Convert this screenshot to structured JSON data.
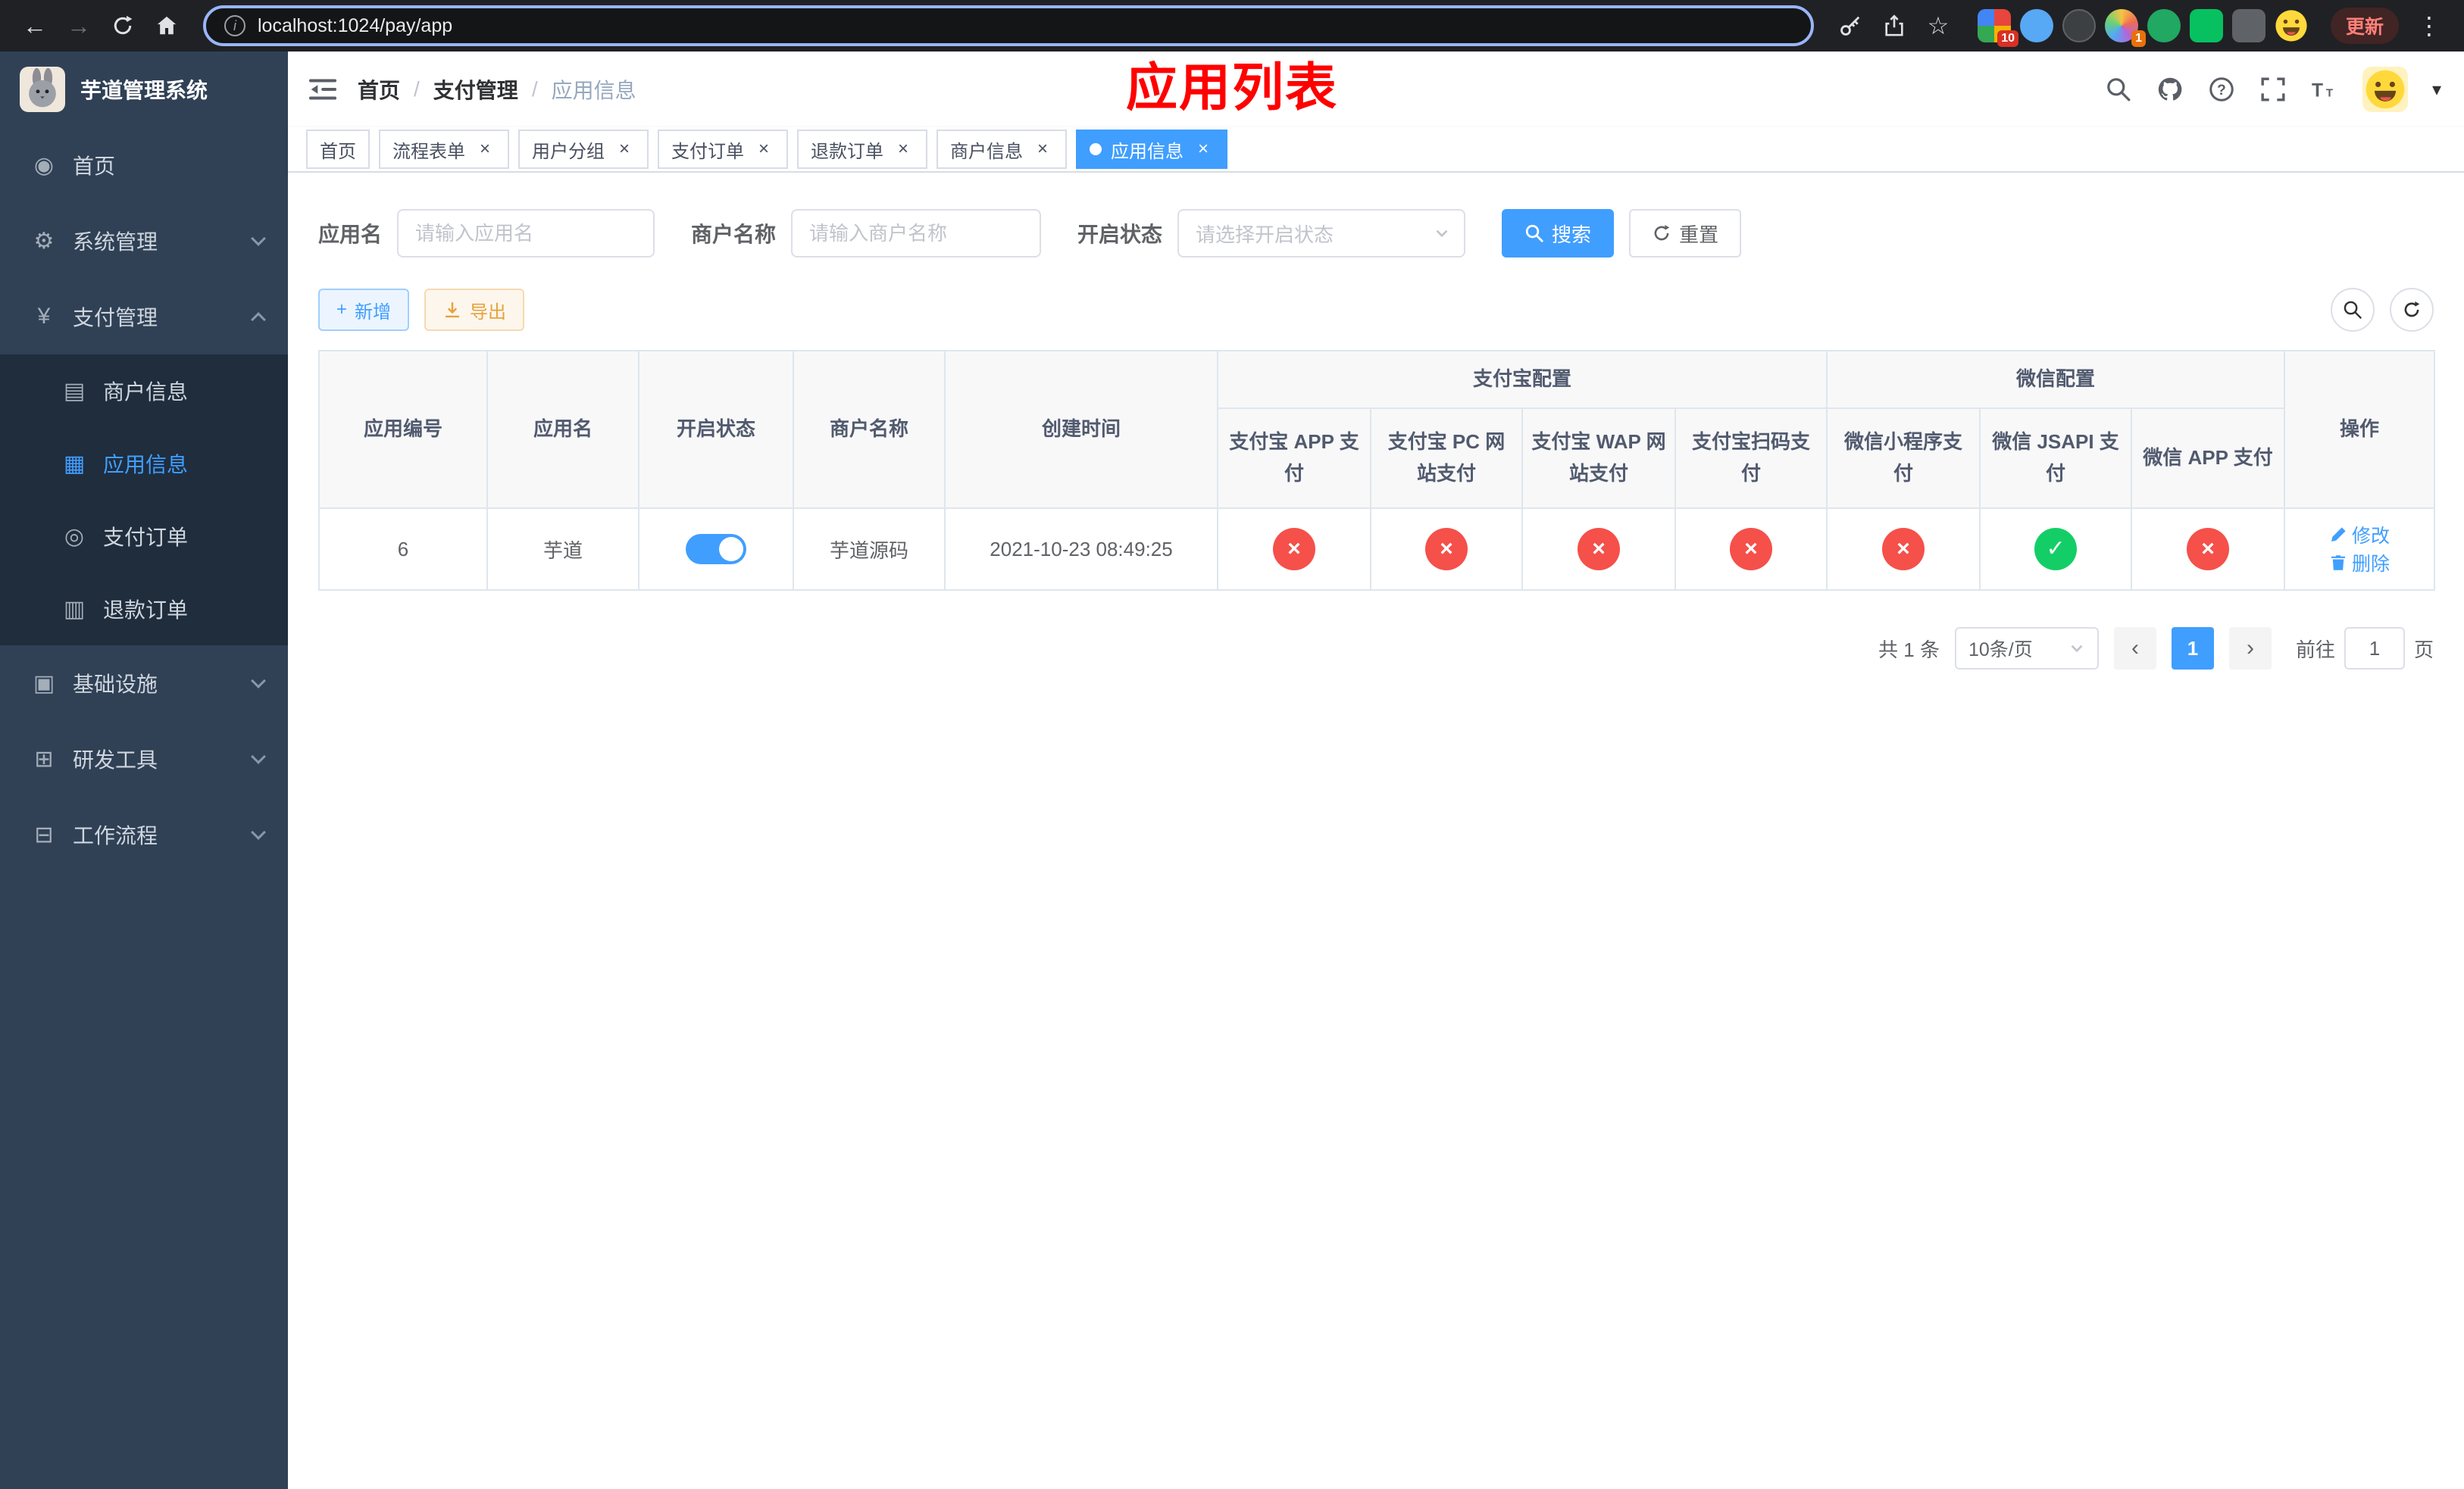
{
  "colors": {
    "accent": "#409eff",
    "success": "#13ce66",
    "danger": "#f5504a",
    "warning": "#e6a23c",
    "annotation_red": "#ff0000",
    "sidebar_bg": "#304156",
    "submenu_bg": "#1f2d3d"
  },
  "icons": {
    "back": "←",
    "forward": "→",
    "bookmark_star": "☆",
    "menu_dots": "⋮",
    "info": "i",
    "caret_down": "▾",
    "close": "×",
    "check": "✓",
    "cross": "×",
    "plus": "+",
    "prev": "‹",
    "next": "›",
    "dashboard": "◉",
    "gear": "⚙",
    "yen": "¥",
    "merchant_card": "▤",
    "app_grid": "▦",
    "pay_order": "◎",
    "refund_order": "▥",
    "infra": "▣",
    "dev_tools": "⊞",
    "workflow": "⊟"
  },
  "browser": {
    "url": "localhost:1024/pay/app",
    "update_label": "更新",
    "badges": {
      "extensions": "10",
      "avatar_ext": "1"
    }
  },
  "sidebar": {
    "title": "芋道管理系统",
    "items": {
      "home": "首页",
      "system": "系统管理",
      "payment": "支付管理",
      "merchant": "商户信息",
      "app": "应用信息",
      "pay_order": "支付订单",
      "refund_order": "退款订单",
      "infra": "基础设施",
      "dev_tools": "研发工具",
      "workflow": "工作流程"
    }
  },
  "header": {
    "breadcrumb": {
      "home": "首页",
      "section": "支付管理",
      "current": "应用信息",
      "sep": "/"
    },
    "annotation": "应用列表"
  },
  "tabs": [
    {
      "label": "首页"
    },
    {
      "label": "流程表单"
    },
    {
      "label": "用户分组"
    },
    {
      "label": "支付订单"
    },
    {
      "label": "退款订单"
    },
    {
      "label": "商户信息"
    },
    {
      "label": "应用信息"
    }
  ],
  "filters": {
    "app_name": {
      "label": "应用名",
      "placeholder": "请输入应用名"
    },
    "merchant_name": {
      "label": "商户名称",
      "placeholder": "请输入商户名称"
    },
    "status": {
      "label": "开启状态",
      "placeholder": "请选择开启状态"
    },
    "search_label": "搜索",
    "reset_label": "重置"
  },
  "toolbar": {
    "add_label": "新增",
    "export_label": "导出"
  },
  "table": {
    "groups": {
      "alipay": "支付宝配置",
      "wechat": "微信配置"
    },
    "columns": {
      "id": "应用编号",
      "name": "应用名",
      "status": "开启状态",
      "merchant": "商户名称",
      "created": "创建时间",
      "alipay_app": "支付宝 APP 支付",
      "alipay_pc": "支付宝 PC 网站支付",
      "alipay_wap": "支付宝 WAP 网站支付",
      "alipay_qr": "支付宝扫码支付",
      "wx_lite": "微信小程序支付",
      "wx_jsapi": "微信 JSAPI 支付",
      "wx_app": "微信 APP 支付",
      "actions": "操作"
    },
    "row": {
      "id": "6",
      "name": "芋道",
      "enabled": true,
      "merchant": "芋道源码",
      "created": "2021-10-23 08:49:25",
      "alipay_app": false,
      "alipay_pc": false,
      "alipay_wap": false,
      "alipay_qr": false,
      "wx_lite": false,
      "wx_jsapi": true,
      "wx_app": false,
      "edit_label": "修改",
      "delete_label": "删除"
    }
  },
  "pagination": {
    "total": "共 1 条",
    "page_size": "10条/页",
    "page": "1",
    "jump_prefix": "前往",
    "jump_value": "1",
    "jump_suffix": "页"
  }
}
